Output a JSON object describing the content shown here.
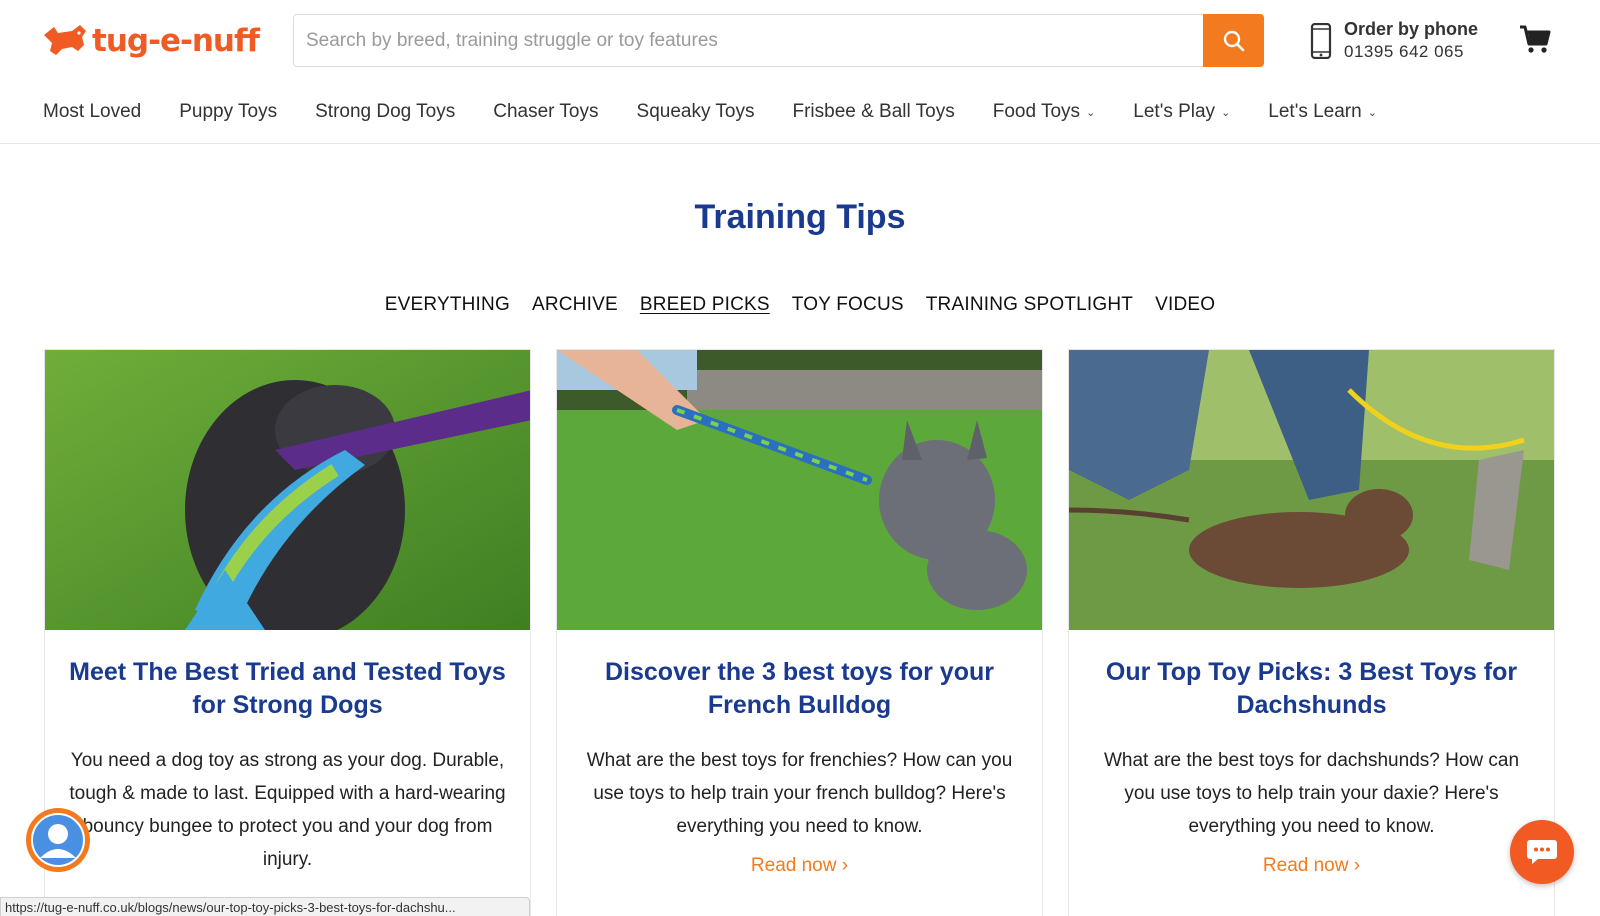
{
  "brand": {
    "name": "tug-e-nuff",
    "accent": "#f47a20",
    "title_color": "#1a3a8f"
  },
  "search": {
    "placeholder": "Search by breed, training struggle or toy features",
    "value": "",
    "icon": "search-icon"
  },
  "contact": {
    "title": "Order by phone",
    "number": "01395 642 065",
    "icon": "phone-icon"
  },
  "cart": {
    "icon": "cart-icon"
  },
  "nav": {
    "items": [
      {
        "label": "Most Loved",
        "dropdown": false
      },
      {
        "label": "Puppy Toys",
        "dropdown": false
      },
      {
        "label": "Strong Dog Toys",
        "dropdown": false
      },
      {
        "label": "Chaser Toys",
        "dropdown": false
      },
      {
        "label": "Squeaky Toys",
        "dropdown": false
      },
      {
        "label": "Frisbee & Ball Toys",
        "dropdown": false
      },
      {
        "label": "Food Toys",
        "dropdown": true
      },
      {
        "label": "Let's Play",
        "dropdown": true
      },
      {
        "label": "Let's Learn",
        "dropdown": true
      }
    ]
  },
  "page": {
    "title": "Training Tips"
  },
  "tags": [
    {
      "label": "EVERYTHING",
      "active": false
    },
    {
      "label": "ARCHIVE",
      "active": false
    },
    {
      "label": "BREED PICKS",
      "active": true
    },
    {
      "label": "TOY FOCUS",
      "active": false
    },
    {
      "label": "TRAINING SPOTLIGHT",
      "active": false
    },
    {
      "label": "VIDEO",
      "active": false
    }
  ],
  "articles": [
    {
      "title": "Meet The Best Tried and Tested Toys for Strong Dogs",
      "excerpt": "You need a dog toy as strong as your dog. Durable, tough & made to last. Equipped with a hard-wearing bouncy bungee to protect you and your dog from injury.",
      "link": ""
    },
    {
      "title": "Discover the 3 best toys for your French Bulldog",
      "excerpt": "What are the best toys for frenchies? How can you use toys to help train your french bulldog? Here's everything you need to know.",
      "link": "Read now"
    },
    {
      "title": "Our Top Toy Picks: 3 Best Toys for Dachshunds",
      "excerpt": "What are the best toys for dachshunds? How can you use toys to help train your daxie? Here's everything you need to know.",
      "link": "Read now"
    }
  ],
  "status_bar": {
    "url": "https://tug-e-nuff.co.uk/blogs/news/our-top-toy-picks-3-best-toys-for-dachshu..."
  },
  "widgets": {
    "account_icon": "user-icon",
    "chat_icon": "chat-icon"
  }
}
